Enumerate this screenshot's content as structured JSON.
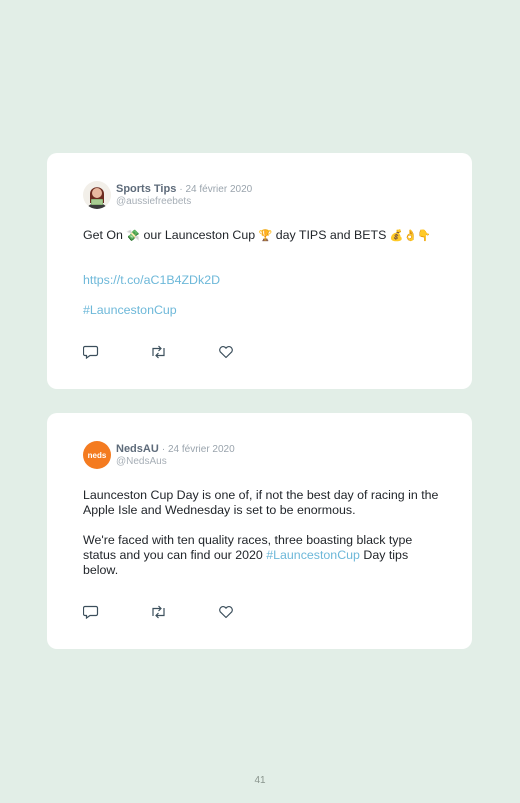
{
  "tweets": [
    {
      "author": "Sports Tips",
      "date": "· 24 février 2020",
      "handle": "@aussiefreebets",
      "text_a": "Get On ",
      "emoji_money": "💸",
      "text_b": " our Launceston Cup ",
      "emoji_trophy": "🏆",
      "text_c": " day TIPS and BETS ",
      "emoji_end": "💰👌👇",
      "link": "https://t.co/aC1B4ZDk2D",
      "hashtag": "#LauncestonCup",
      "avatar_icon": "woman-with-cash-avatar"
    },
    {
      "author": "NedsAU",
      "date": "· 24 février 2020",
      "handle": "@NedsAus",
      "avatar_text": "neds",
      "avatar_color": "#f47b20",
      "paragraph1": "Launceston Cup Day is one of, if not the best day of racing in the Apple Isle and Wednesday is set to be enormous.",
      "paragraph2_a": "We're faced with ten quality races, three boasting black type status and you can find our 2020 ",
      "hashtag": "#LauncestonCup",
      "paragraph2_b": " Day tips below."
    }
  ],
  "actions": [
    "reply-icon",
    "retweet-icon",
    "like-icon"
  ],
  "page_number": "41",
  "colors": {
    "background": "#e2eee7",
    "card": "#ffffff",
    "link": "#6db8d9",
    "neds_orange": "#f47b20"
  }
}
